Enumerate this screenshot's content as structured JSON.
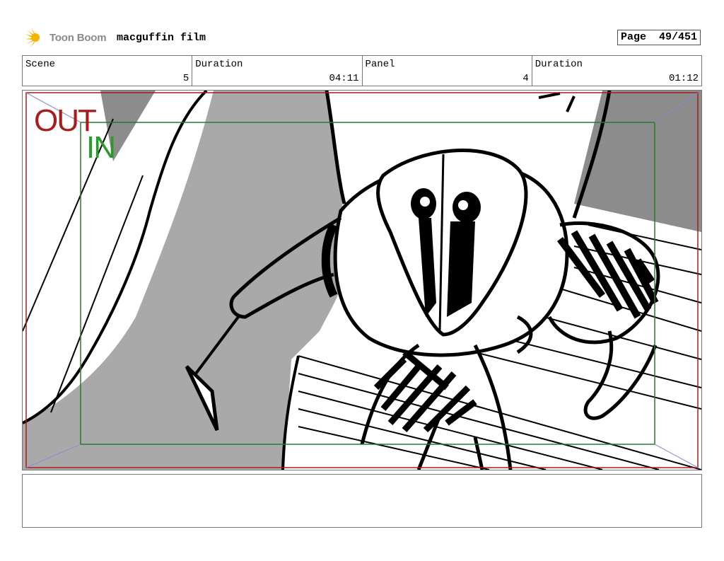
{
  "header": {
    "logo_text": "Toon Boom",
    "project_title": "macguffin film",
    "page_label": "Page",
    "page_value": "49/451"
  },
  "info": {
    "scene_label": "Scene",
    "scene_value": "5",
    "scene_duration_label": "Duration",
    "scene_duration_value": "04:11",
    "panel_label": "Panel",
    "panel_value": "4",
    "panel_duration_label": "Duration",
    "panel_duration_value": "01:12"
  },
  "panel": {
    "field_out_label": "OUT",
    "field_in_label": "IN",
    "out_color": "#a81c1c",
    "in_color": "#2a9a2a"
  },
  "notes": {
    "text": ""
  }
}
